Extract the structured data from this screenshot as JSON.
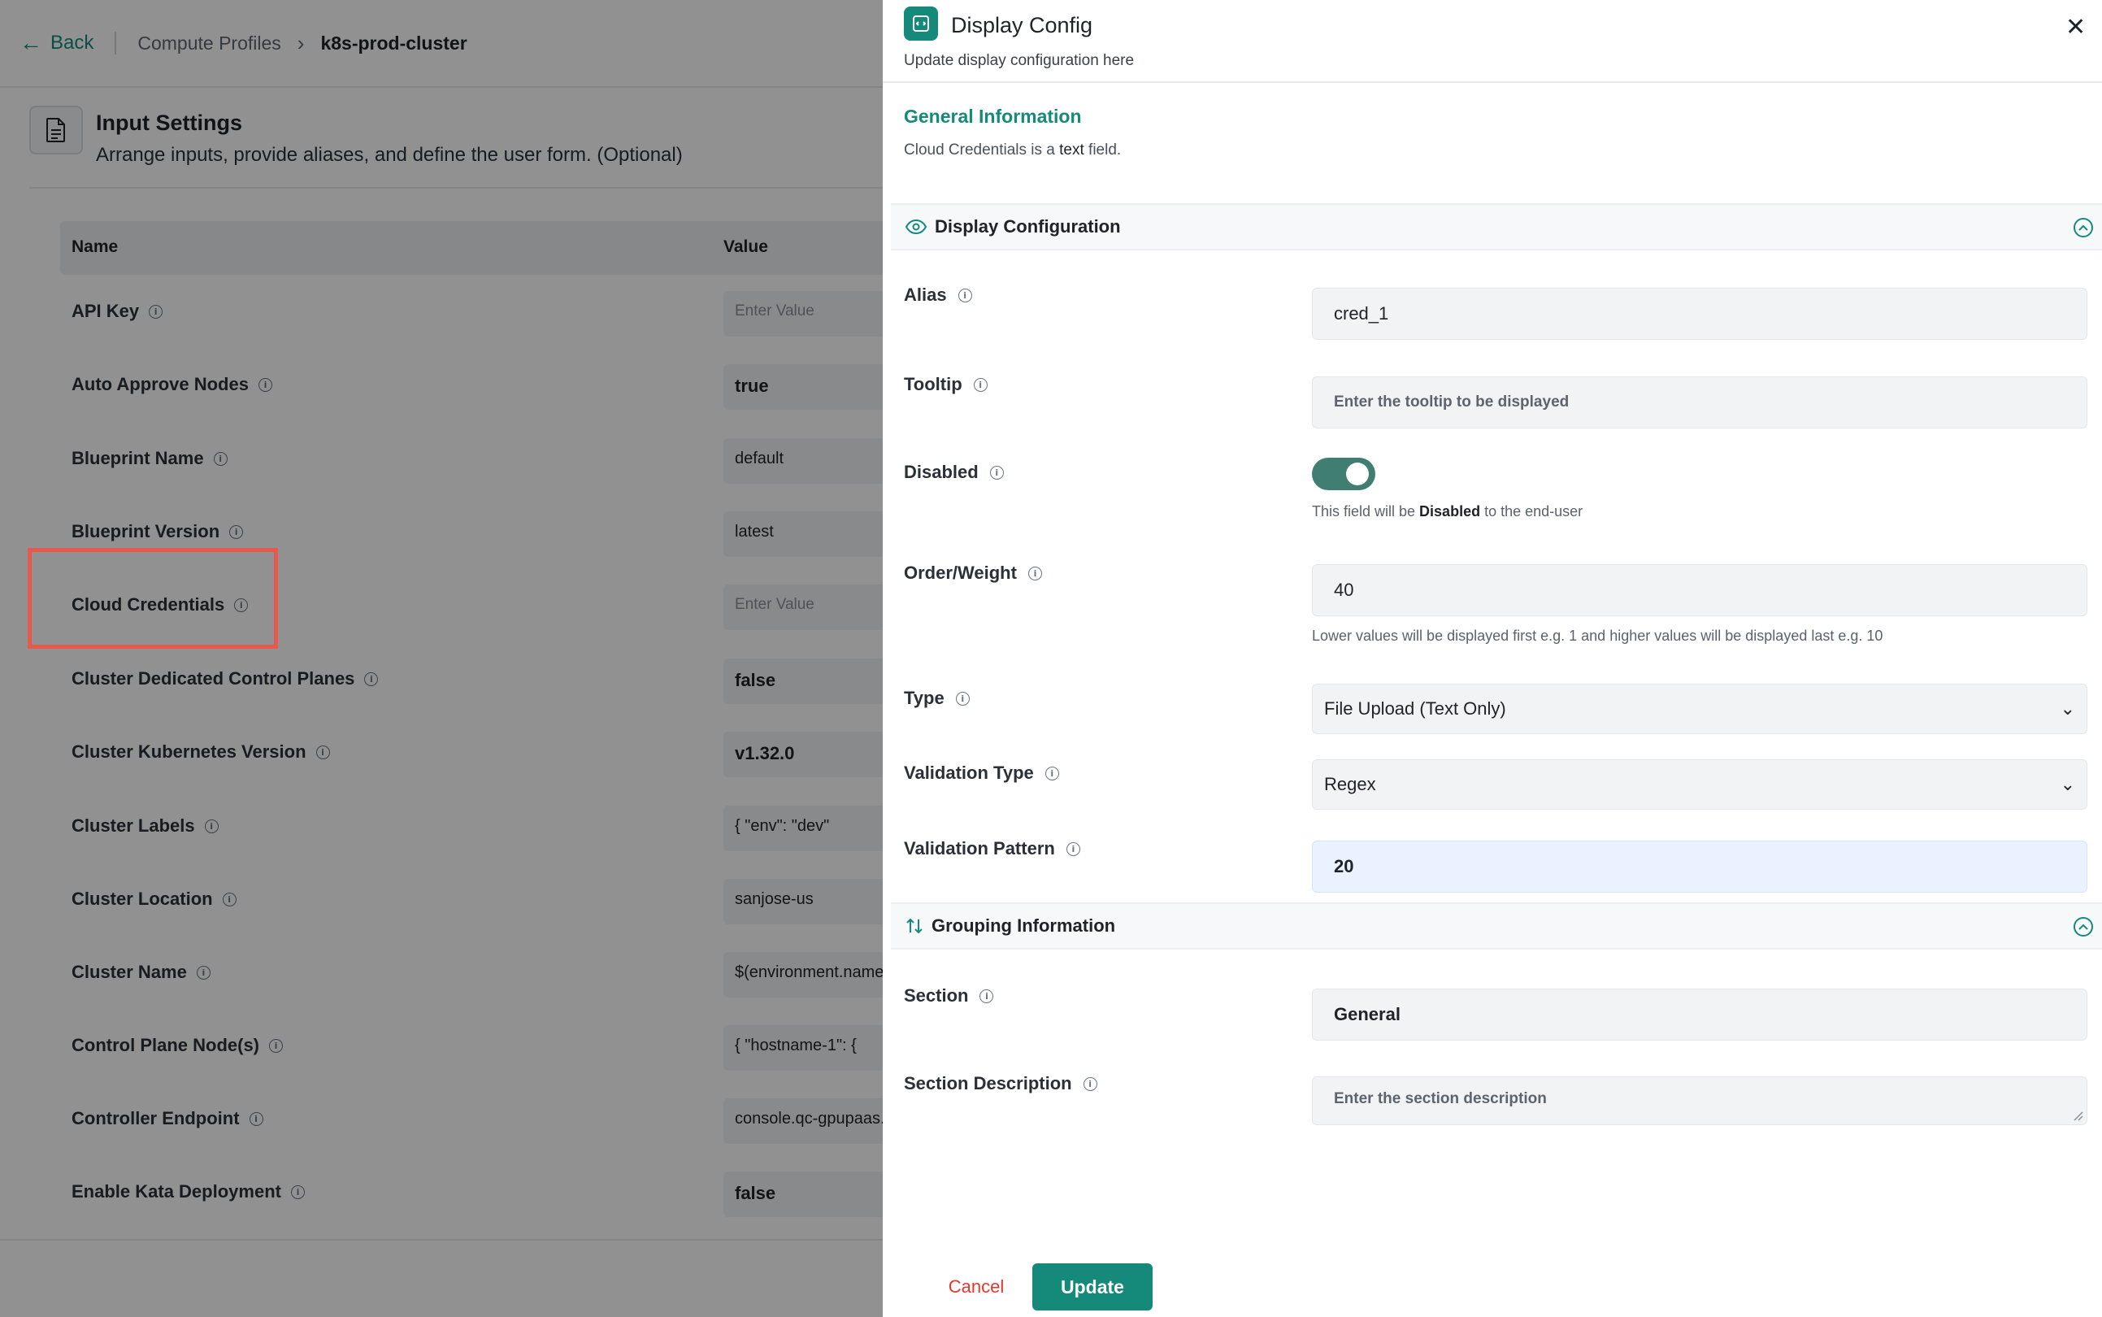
{
  "topbar": {
    "back_label": "Back",
    "breadcrumb_parent": "Compute Profiles",
    "breadcrumb_current": "k8s-prod-cluster"
  },
  "input_settings": {
    "title": "Input Settings",
    "subtitle": "Arrange inputs, provide aliases, and define the user form. (Optional)",
    "columns": {
      "name": "Name",
      "value": "Value"
    },
    "rows": [
      {
        "name": "API Key",
        "value": "Enter Value",
        "placeholder": true
      },
      {
        "name": "Auto Approve Nodes",
        "value": "true"
      },
      {
        "name": "Blueprint Name",
        "value": "default"
      },
      {
        "name": "Blueprint Version",
        "value": "latest"
      },
      {
        "name": "Cloud Credentials",
        "value": "Enter Value",
        "placeholder": true,
        "highlighted": true
      },
      {
        "name": "Cluster Dedicated Control Planes",
        "value": "false"
      },
      {
        "name": "Cluster Kubernetes Version",
        "value": "v1.32.0"
      },
      {
        "name": "Cluster Labels",
        "value": "{ \"env\": \"dev\""
      },
      {
        "name": "Cluster Location",
        "value": "sanjose-us"
      },
      {
        "name": "Cluster Name",
        "value": "$(environment.name)"
      },
      {
        "name": "Control Plane Node(s)",
        "value": "{ \"hostname-1\": {"
      },
      {
        "name": "Controller Endpoint",
        "value": "console.qc-gpupaas.c"
      },
      {
        "name": "Enable Kata Deployment",
        "value": "false"
      }
    ]
  },
  "drawer": {
    "title": "Display Config",
    "subtitle": "Update display configuration here",
    "general_info": {
      "title": "General Information",
      "field_name": "Cloud Credentials",
      "sentence_middle": " is a ",
      "field_type": "text",
      "sentence_end": " field."
    },
    "display_configuration": {
      "title": "Display Configuration",
      "alias": {
        "label": "Alias",
        "value": "cred_1"
      },
      "tooltip": {
        "label": "Tooltip",
        "placeholder": "Enter the tooltip to be displayed"
      },
      "disabled": {
        "label": "Disabled",
        "on": true,
        "help_prefix": "This field will be ",
        "help_bold": "Disabled",
        "help_suffix": " to the end-user"
      },
      "order_weight": {
        "label": "Order/Weight",
        "value": "40",
        "help": "Lower values will be displayed first e.g. 1 and higher values will be displayed last e.g. 10"
      },
      "type": {
        "label": "Type",
        "value": "File Upload (Text Only)"
      },
      "validation_type": {
        "label": "Validation Type",
        "value": "Regex"
      },
      "validation_pattern": {
        "label": "Validation Pattern",
        "value": "20"
      }
    },
    "grouping_information": {
      "title": "Grouping Information",
      "section": {
        "label": "Section",
        "value": "General"
      },
      "section_description": {
        "label": "Section Description",
        "placeholder": "Enter the section description"
      }
    },
    "buttons": {
      "cancel": "Cancel",
      "update": "Update"
    }
  },
  "colors": {
    "accent": "#15897a",
    "danger": "#e5372b",
    "highlight_border": "#e8594d",
    "toggle_on": "#3f7e70"
  },
  "icons": [
    "back-arrow-icon",
    "chevron-right-icon",
    "document-icon",
    "info-icon",
    "display-config-icon",
    "close-icon",
    "eye-icon",
    "chevron-up-circle-icon",
    "sort-arrows-icon",
    "chevron-down-icon"
  ]
}
